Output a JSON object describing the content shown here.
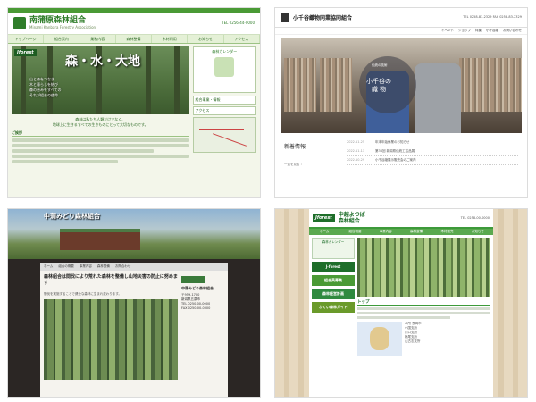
{
  "tile1": {
    "title": "南蒲原森林組合",
    "subtitle": "Minami Kanbara Forestry Association",
    "tel": "TEL 0256-44-0000",
    "nav": [
      "トップページ",
      "組合案内",
      "業務内容",
      "森林整備",
      "木材利用",
      "お知らせ",
      "アクセス"
    ],
    "brand": "Jforest",
    "hero_text": "森・水・大地",
    "hero_message": "山と森をつなぎ\n木と暮らしを結び\n森の恵みをすべての\nそれが組合の使命",
    "tagline": "森林は私たち人類だけでなく、\n地球上に生きるすべての生きものにとって大切なものです。",
    "section_heading": "ご挨拶",
    "side_calendar": "森林カレンダー",
    "side_links": [
      "組合事業・情報",
      "アクセス"
    ]
  },
  "tile2": {
    "title": "小千谷織物同業協同組合",
    "tel": "TEL 0258-83-2329  FAX 0258-83-2329",
    "nav": [
      "イベント",
      "ショップ",
      "特集",
      "小千谷縮",
      "お問い合わせ"
    ],
    "circle_tag": "伝統の技術",
    "circle_text": "小千谷の\n織 物",
    "news_heading": "新着情報",
    "news_more": "一覧を見る ›",
    "news": [
      {
        "date": "2022.11.25",
        "text": "年末年始休業のお知らせ"
      },
      {
        "date": "2022.11.11",
        "text": "第36回 新潟県伝統工芸品展"
      },
      {
        "date": "2022.10.29",
        "text": "小千谷縮展示販売会のご案内"
      }
    ]
  },
  "tile3": {
    "title": "中蒲みどり森林組合",
    "nav": [
      "ホーム",
      "組合の概要",
      "事業内容",
      "森林整備",
      "お問合わせ"
    ],
    "heading": "森林組合は間伐により荒れた森林を整備し山地災害の防止に努めます",
    "paragraph": "間伐を実施することで健全な森林に生まれ変わります。",
    "org_name": "中蒲みどり森林組合",
    "org_lines": [
      "〒959-1700",
      "新潟県五泉市",
      "TEL 0250-00-0000",
      "FAX 0250-00-0000"
    ]
  },
  "tile4": {
    "brand": "Jforest",
    "title": "中越よつば\n森林組合",
    "tel": "TEL 0258-00-0000",
    "nav": [
      "ホーム",
      "組合概要",
      "事業内容",
      "森林整備",
      "木材販売",
      "お知らせ"
    ],
    "side_box": "森林カレンダー",
    "banners": [
      {
        "label": "J-forest",
        "color": "#1e6e2a"
      },
      {
        "label": "組合員募集",
        "color": "#4a9a35"
      },
      {
        "label": "森林経営計画",
        "color": "#2f8a3f"
      },
      {
        "label": "ふくい森林ガイド",
        "color": "#6a9a2a"
      }
    ],
    "section_heading": "トップ",
    "address_lines": [
      "本所 長岡市",
      "小国支所",
      "川口支所",
      "栃尾支所",
      "山古志支所"
    ]
  }
}
